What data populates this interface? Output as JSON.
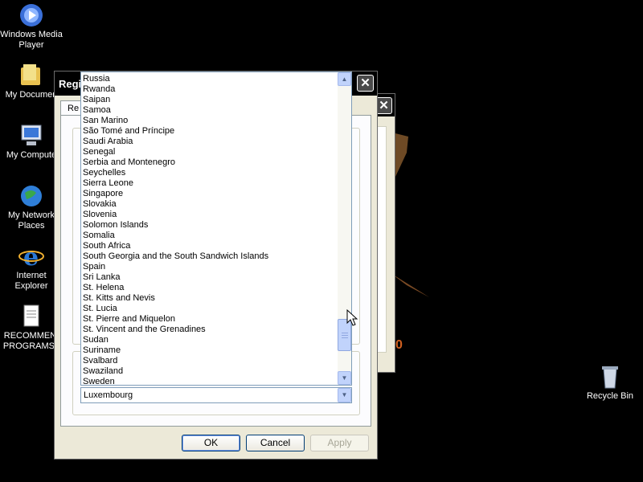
{
  "desktop": {
    "icons": [
      {
        "label": "Windows Media\nPlayer",
        "icon": "windows-media-player-icon"
      },
      {
        "label": "My Documen",
        "icon": "folder-icon"
      },
      {
        "label": "My Compute",
        "icon": "computer-icon"
      },
      {
        "label": "My Network\nPlaces",
        "icon": "globe-icon"
      },
      {
        "label": "Internet\nExplorer",
        "icon": "internet-explorer-icon"
      },
      {
        "label": "RECOMMEN.\nPROGRAMS .",
        "icon": "document-icon"
      },
      {
        "label": "Recycle Bin",
        "icon": "recycle-bin-icon"
      }
    ]
  },
  "dialog": {
    "title": "Regi",
    "tab_label": "Re",
    "buttons": {
      "ok": "OK",
      "cancel": "Cancel",
      "apply": "Apply"
    },
    "close_glyph": "✕"
  },
  "back_window": {
    "close_glyph": "✕",
    "edge_char": "0"
  },
  "country_list": {
    "items": [
      "Russia",
      "Rwanda",
      "Saipan",
      "Samoa",
      "San Marino",
      "São Tomé and Príncipe",
      "Saudi Arabia",
      "Senegal",
      "Serbia and Montenegro",
      "Seychelles",
      "Sierra Leone",
      "Singapore",
      "Slovakia",
      "Slovenia",
      "Solomon Islands",
      "Somalia",
      "South Africa",
      "South Georgia and the South Sandwich Islands",
      "Spain",
      "Sri Lanka",
      "St. Helena",
      "St. Kitts and Nevis",
      "St. Lucia",
      "St. Pierre and Miquelon",
      "St. Vincent and the Grenadines",
      "Sudan",
      "Suriname",
      "Svalbard",
      "Swaziland",
      "Sweden"
    ],
    "scroll_position": 0.92
  },
  "combo": {
    "selected": "Luxembourg"
  },
  "scroll_glyphs": {
    "up": "▲",
    "down": "▼"
  },
  "colors": {
    "xp_face": "#ece9d8",
    "list_border": "#7f9db9",
    "scroll_blue": "#c1d3fb"
  }
}
